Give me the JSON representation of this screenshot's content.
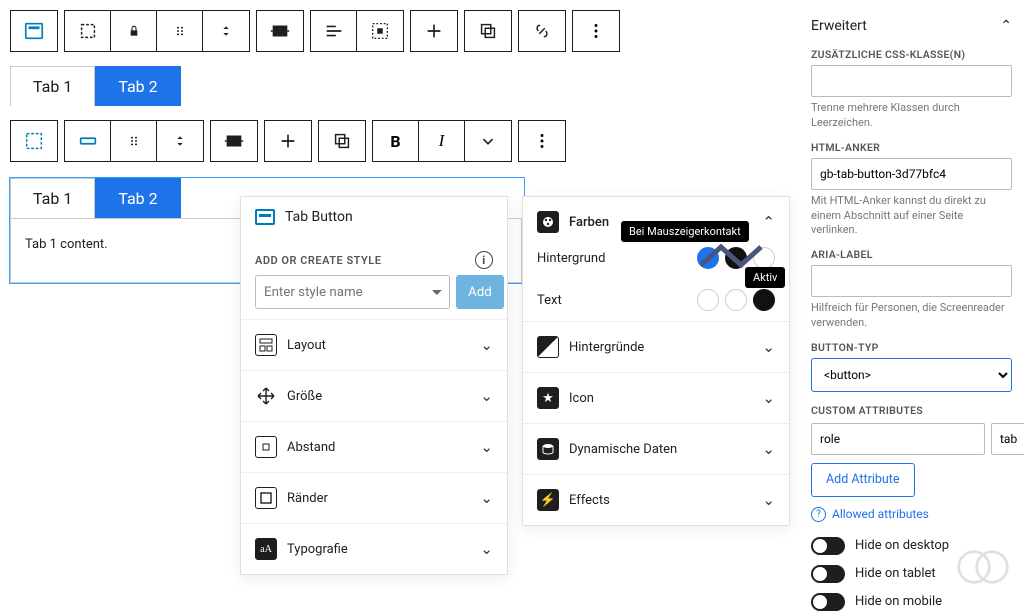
{
  "toolbar1": {
    "icons": [
      "block-icon",
      "marquee-icon",
      "lock-icon",
      "drag-icon",
      "sort-icon",
      "select-all-icon",
      "align-left-icon",
      "box-dashed-icon",
      "plus-icon",
      "duplicate-icon",
      "link-icon",
      "more-icon"
    ]
  },
  "tabs1": {
    "items": [
      "Tab 1",
      "Tab 2"
    ],
    "active_index": 1
  },
  "tabs2": {
    "items": [
      "Tab 1",
      "Tab 2"
    ],
    "active_index": 1,
    "content": "Tab 1 content."
  },
  "panel_left": {
    "title": "Tab Button",
    "add_style_label": "ADD OR CREATE STYLE",
    "add_style_placeholder": "Enter style name",
    "add_button": "Add",
    "items": [
      "Layout",
      "Größe",
      "Abstand",
      "Ränder",
      "Typografie"
    ]
  },
  "panel_mid": {
    "header": "Farben",
    "rows": [
      {
        "label": "Hintergrund",
        "tooltip_hover": "Bei Mauszeigerkontakt"
      },
      {
        "label": "Text",
        "tooltip_aktiv": "Aktiv"
      }
    ],
    "items": [
      "Hintergründe",
      "Icon",
      "Dynamische Daten",
      "Effects"
    ]
  },
  "sidebar": {
    "section": "Erweitert",
    "css_label": "ZUSÄTZLICHE CSS-KLASSE(N)",
    "css_help": "Trenne mehrere Klassen durch Leerzeichen.",
    "anchor_label": "HTML-ANKER",
    "anchor_value": "gb-tab-button-3d77bfc4",
    "anchor_help": "Mit HTML-Anker kannst du direkt zu einem Abschnitt auf einer Seite verlinken.",
    "aria_label": "ARIA-LABEL",
    "aria_help": "Hilfreich für Personen, die Screenreader verwenden.",
    "button_type_label": "BUTTON-TYP",
    "button_type_value": "<button>",
    "custom_attr_label": "CUSTOM ATTRIBUTES",
    "attr_key": "role",
    "attr_val": "tab",
    "add_attr": "Add Attribute",
    "allowed": "Allowed attributes",
    "hide_desktop": "Hide on desktop",
    "hide_tablet": "Hide on tablet",
    "hide_mobile": "Hide on mobile"
  }
}
